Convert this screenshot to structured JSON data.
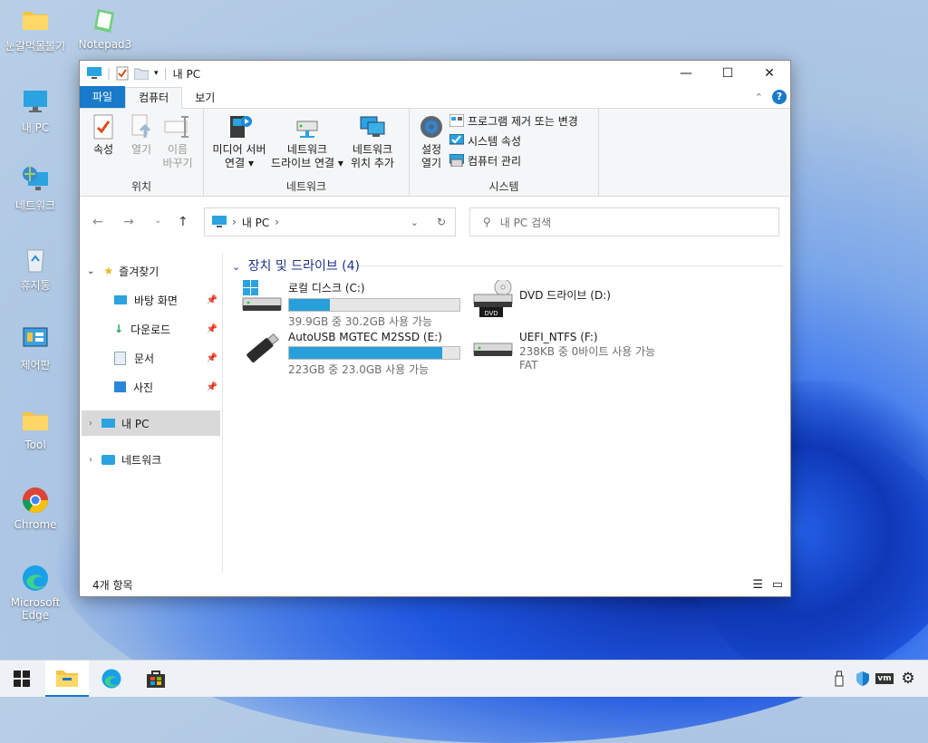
{
  "desktop": {
    "icons": [
      {
        "label": "눈갈먹몰볼기"
      },
      {
        "label": "Notepad3"
      },
      {
        "label": "내 PC"
      },
      {
        "label": "네트워크"
      },
      {
        "label": "휴지통"
      },
      {
        "label": "제어판"
      },
      {
        "label": "Tool"
      },
      {
        "label": "Chrome"
      },
      {
        "label": "Microsoft Edge"
      }
    ]
  },
  "window": {
    "title": "내 PC",
    "controls": {
      "minimize": "—",
      "maximize": "☐",
      "close": "✕"
    },
    "tabs": {
      "file": "파일",
      "computer": "컴퓨터",
      "view": "보기"
    },
    "ribbon": {
      "location": {
        "label": "위치",
        "properties": "속성",
        "open": "열기",
        "rename_1": "이름",
        "rename_2": "바꾸기"
      },
      "network": {
        "label": "네트워크",
        "media_1": "미디어 서버",
        "media_2": "연결",
        "map_1": "네트워크",
        "map_2": "드라이브 연결",
        "add_1": "네트워크",
        "add_2": "위치 추가"
      },
      "system": {
        "label": "시스템",
        "settings_1": "설정",
        "settings_2": "열기",
        "uninstall": "프로그램 제거 또는 변경",
        "sys_props": "시스템 속성",
        "manage": "컴퓨터 관리"
      }
    },
    "address": {
      "path": "내 PC",
      "search_placeholder": "내 PC 검색"
    },
    "nav": {
      "favorites": "즐겨찾기",
      "desktop": "바탕 화면",
      "downloads": "다운로드",
      "documents": "문서",
      "pictures": "사진",
      "this_pc": "내 PC",
      "network": "네트워크"
    },
    "content": {
      "section": "장치 및 드라이브 (4)",
      "drives": [
        {
          "name": "로컬 디스크 (C:)",
          "info": "39.9GB 중 30.2GB 사용 가능",
          "used_fraction": 0.24
        },
        {
          "name": "DVD 드라이브 (D:)",
          "badge": "DVD"
        },
        {
          "name": "AutoUSB MGTEC M2SSD (E:)",
          "info": "223GB 중 23.0GB 사용 가능",
          "used_fraction": 0.9
        },
        {
          "name": "UEFI_NTFS (F:)",
          "info": "238KB 중 0바이트 사용 가능",
          "fs": "FAT"
        }
      ]
    },
    "status": {
      "items": "4개 항목"
    }
  },
  "colors": {
    "accent": "#1979ca",
    "bar_fill": "#26a0da",
    "section_title": "#1e3287"
  }
}
